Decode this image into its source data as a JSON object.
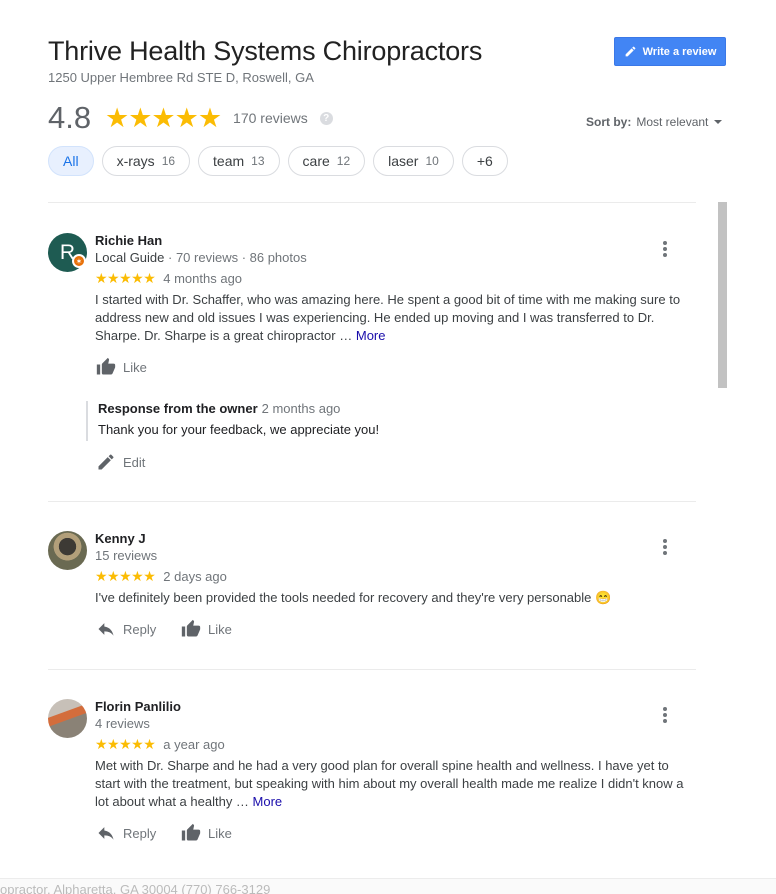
{
  "business": {
    "name": "Thrive Health Systems Chiropractors",
    "address": "1250 Upper Hembree Rd STE D, Roswell, GA"
  },
  "write_review_label": "Write a review",
  "summary": {
    "rating": "4.8",
    "stars": "★★★★★",
    "review_count": "170 reviews",
    "help_icon": "?"
  },
  "sort": {
    "label": "Sort by:",
    "value": "Most relevant"
  },
  "chips": [
    {
      "label": "All",
      "count": ""
    },
    {
      "label": "x-rays",
      "count": "16"
    },
    {
      "label": "team",
      "count": "13"
    },
    {
      "label": "care",
      "count": "12"
    },
    {
      "label": "laser",
      "count": "10"
    },
    {
      "label": "+6",
      "count": ""
    }
  ],
  "reviews": [
    {
      "avatar_letter": "R",
      "name": "Richie Han",
      "guide": "Local Guide",
      "meta": " · 70 reviews · 86 photos",
      "stars": "★★★★★",
      "date": "4 months ago",
      "text": "I started with Dr. Schaffer, who was amazing here. He spent a good bit of time with me making sure to address new and old issues I was experiencing. He ended up moving and I was transferred to Dr. Sharpe. Dr. Sharpe is a great chiropractor … ",
      "more": "More",
      "like_label": "Like",
      "owner_title": "Response from the owner",
      "owner_date": "2 months ago",
      "owner_text": "Thank you for your feedback, we appreciate you!",
      "edit_label": "Edit"
    },
    {
      "name": "Kenny J",
      "meta": "15 reviews",
      "stars": "★★★★★",
      "date": "2 days ago",
      "text": "I've definitely been provided the tools needed for recovery and they're very personable 😁",
      "reply_label": "Reply",
      "like_label": "Like"
    },
    {
      "name": "Florin Panlilio",
      "meta": "4 reviews",
      "stars": "★★★★★",
      "date": "a year ago",
      "text": "Met with Dr. Sharpe and he had a very good plan for overall spine health and wellness. I have yet to start with the treatment, but speaking with him about my overall health made me realize I didn't know a lot about what a healthy … ",
      "more": "More",
      "reply_label": "Reply",
      "like_label": "Like"
    }
  ],
  "footer_text": "opractor, Alpharetta, GA 30004 (770) 766-3129",
  "colors": {
    "accent": "#4285f4",
    "star": "#fbbc04",
    "link": "#1a0dab"
  }
}
